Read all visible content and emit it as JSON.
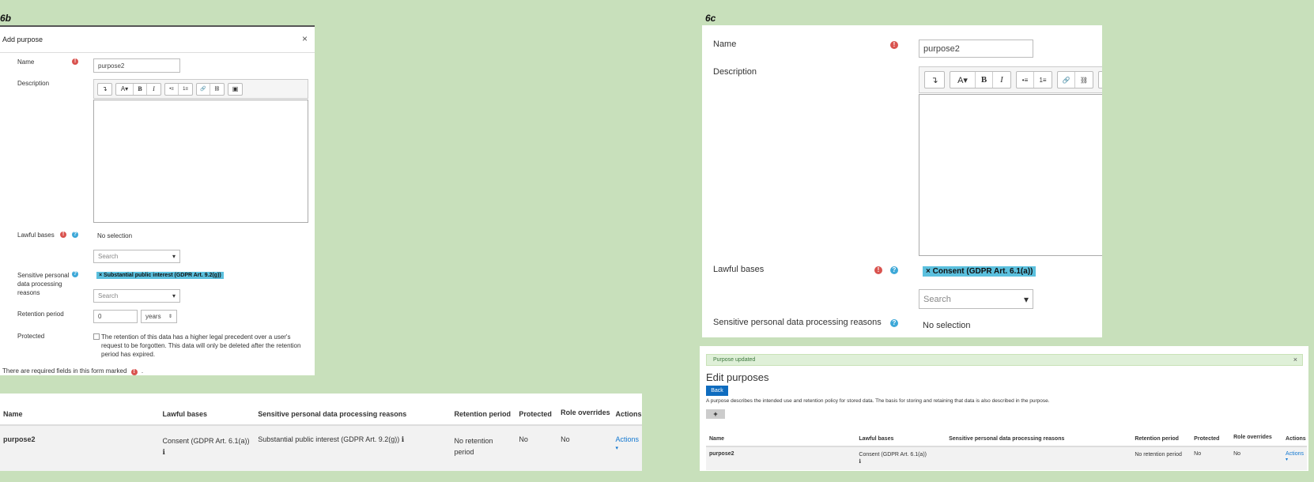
{
  "fig6b": {
    "label": "6b",
    "dialog": {
      "title": "Add purpose",
      "close": "×",
      "name_label": "Name",
      "name_value": "purpose2",
      "description_label": "Description",
      "lawful_label": "Lawful bases",
      "lawful_value": "No selection",
      "lawful_search": "Search",
      "sensitive_label": "Sensitive personal data processing reasons",
      "sensitive_tag": "× Substantial public interest (GDPR Art. 9.2(g))",
      "sensitive_search": "Search",
      "retention_label": "Retention period",
      "retention_value": "0",
      "retention_unit": "years",
      "protected_label": "Protected",
      "protected_text": "The retention of this data has a higher legal precedent over a user's request to be forgotten. This data will only be deleted after the retention period has expired.",
      "required_note": "There are required fields in this form marked",
      "required_note_end": "."
    },
    "table": {
      "headers": [
        "Name",
        "Lawful bases",
        "Sensitive personal data processing reasons",
        "Retention period",
        "Protected",
        "Role overrides",
        "Actions"
      ],
      "row": {
        "name": "purpose2",
        "lawful": "Consent (GDPR Art. 6.1(a))",
        "sensitive": "Substantial public interest (GDPR Art. 9.2(g))",
        "retention": "No retention period",
        "protected": "No",
        "role_overrides": "No",
        "actions": "Actions"
      }
    }
  },
  "fig6c": {
    "label": "6c",
    "form": {
      "name_label": "Name",
      "name_value": "purpose2",
      "description_label": "Description",
      "lawful_label": "Lawful bases",
      "lawful_tag": "× Consent (GDPR Art. 6.1(a))",
      "lawful_search": "Search",
      "sensitive_label": "Sensitive personal data processing reasons",
      "sensitive_value": "No selection"
    },
    "page": {
      "alert": "Purpose updated",
      "alert_close": "×",
      "heading": "Edit purposes",
      "back": "Back",
      "description": "A purpose describes the intended use and retention policy for stored data. The basis for storing and retaining that data is also described in the purpose.",
      "add": "+",
      "headers": [
        "Name",
        "Lawful bases",
        "Sensitive personal data processing reasons",
        "Retention period",
        "Protected",
        "Role overrides",
        "Actions"
      ],
      "row": {
        "name": "purpose2",
        "lawful": "Consent (GDPR Art. 6.1(a))",
        "sensitive": "",
        "retention": "No retention period",
        "protected": "No",
        "role_overrides": "No",
        "actions": "Actions"
      }
    }
  },
  "editor_buttons": [
    "↴",
    "A▾",
    "B",
    "I",
    "•≡",
    "1≡",
    "🔗",
    "⛓",
    "▣"
  ],
  "icons": {
    "info": "ℹ",
    "required": "!",
    "help": "?",
    "dropdown": "▾"
  },
  "colors": {
    "background": "#c8e0bb",
    "link": "#1177d1",
    "tag": "#5bc0de",
    "required": "#d9534f",
    "help": "#3da8d8",
    "alert_bg": "#dff0d8",
    "primary_button": "#0f6cbf"
  }
}
